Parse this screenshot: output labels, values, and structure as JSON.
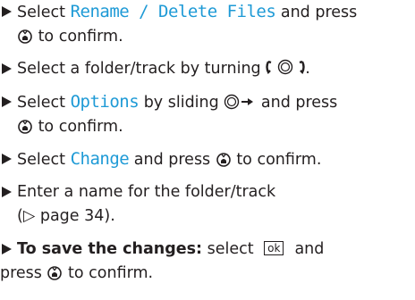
{
  "steps": [
    {
      "pre": "Select ",
      "display_term": "Rename / Delete Files",
      "post": " and press",
      "line2_post": " to confirm."
    },
    {
      "pre": "Select a folder/track by turning ",
      "post": "."
    },
    {
      "pre": "Select ",
      "display_term": "Options",
      "post": " by sliding ",
      "post2": " and press",
      "line2_post": " to confirm."
    },
    {
      "pre": "Select ",
      "display_term": "Change",
      "post": " and press ",
      "post2": " to confirm."
    },
    {
      "line1": "Enter a name for the folder/track",
      "line2": "(▷ page 34)."
    },
    {
      "bold": "To save the changes:",
      "pre": " select ",
      "ok_label": "ok",
      "line2_pre": "press ",
      "line2_post": " to confirm."
    }
  ],
  "icons": {
    "bullet": "triangle-bullet-icon",
    "press": "controller-press-icon",
    "turn": "controller-turn-icon",
    "slide": "controller-slide-right-icon"
  },
  "colors": {
    "display_text": "#1e9ad6",
    "text": "#231f20"
  }
}
